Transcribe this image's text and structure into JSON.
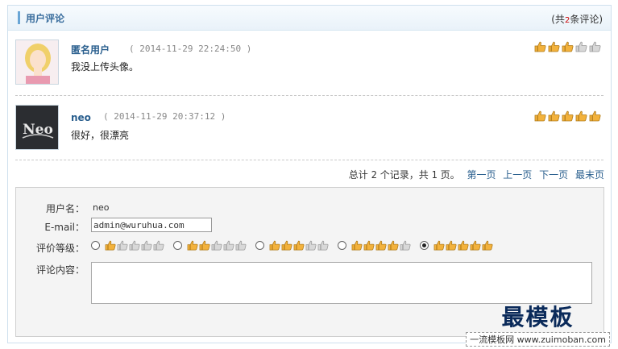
{
  "header": {
    "title": "用户评论",
    "count_prefix": "(共",
    "count_value": "2",
    "count_suffix": "条评论)"
  },
  "comments": [
    {
      "name": "匿名用户",
      "time": "( 2014-11-29 22:24:50 )",
      "text": "我没上传头像。",
      "rating": 3,
      "avatar": "female-avatar"
    },
    {
      "name": "neo",
      "time": "( 2014-11-29 20:37:12 )",
      "text": "很好，很漂亮",
      "rating": 5,
      "avatar": "neo-avatar",
      "avatar_text": "Neo"
    }
  ],
  "pager": {
    "summary_1": "总计",
    "total": "2",
    "summary_2": "个记录，共",
    "pages": "1",
    "summary_3": "页。",
    "first": "第一页",
    "prev": "上一页",
    "next": "下一页",
    "last": "最末页"
  },
  "form": {
    "username_label": "用户名：",
    "username_value": "neo",
    "email_label": "E-mail：",
    "email_value": "admin@wuruhua.com",
    "rating_label": "评价等级：",
    "rating_selected": 5,
    "content_label": "评论内容：",
    "content_value": ""
  },
  "watermark": {
    "big": "最模板",
    "small": "一流模板网 www.zuimoban.com"
  },
  "colors": {
    "accent": "#2a5f8e",
    "thumb_on": "#f3b23c",
    "thumb_off": "#d8d8d8"
  }
}
